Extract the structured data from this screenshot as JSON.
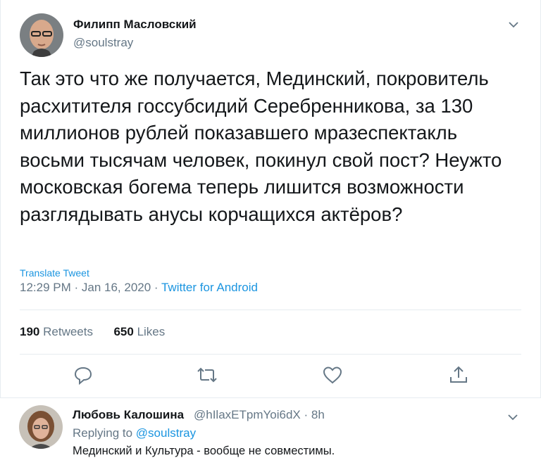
{
  "tweet": {
    "author_name": "Филипп Масловский",
    "author_handle": "@soulstray",
    "text": "Так это что же получается, Мединский, покровитель расхитителя госсубсидий Серебренникова, за 130 миллионов рублей показавшего мразеспектакль восьми тысячам человек, покинул свой пост? Неужто московская богема теперь лишится возможности разглядывать анусы корчащихся актёров?",
    "translate_label": "Translate Tweet",
    "timestamp": "12:29 PM · Jan 16, 2020 · ",
    "source": "Twitter for Android",
    "retweets_count": "190",
    "retweets_label": "Retweets",
    "likes_count": "650",
    "likes_label": "Likes"
  },
  "actions": {
    "icons": [
      "reply-icon",
      "retweet-icon",
      "like-icon",
      "share-icon"
    ]
  },
  "reply": {
    "author_name": "Любовь Калошина",
    "author_handle": "@hIlaxETpmYoi6dX · 8h",
    "replying_prefix": "Replying to ",
    "replying_to": "@soulstray",
    "text": "Мединский и Культура - вообще не совместимы."
  },
  "colors": {
    "accent": "#1b95e0",
    "muted": "#657786",
    "border": "#e6ecf0"
  }
}
